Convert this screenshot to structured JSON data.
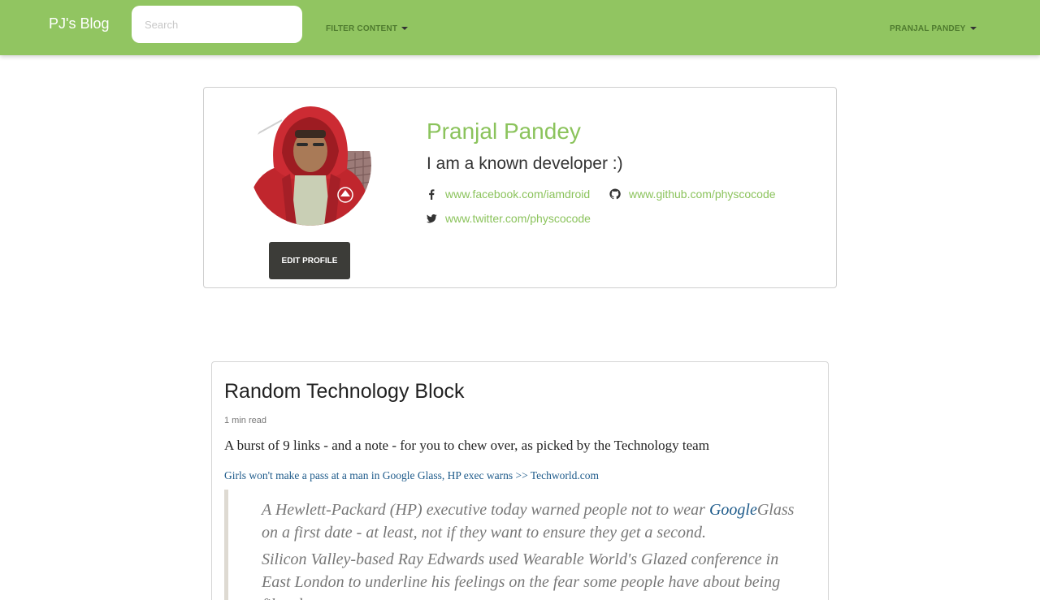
{
  "navbar": {
    "brand": "PJ's Blog",
    "search_placeholder": "Search",
    "filter_label": "FILTER CONTENT",
    "user_label": "PRANJAL PANDEY",
    "bg_color": "#91c561"
  },
  "profile": {
    "name": "Pranjal Pandey",
    "bio": "I am a known developer :)",
    "edit_button": "EDIT PROFILE",
    "links": {
      "facebook": {
        "icon": "facebook-icon",
        "text": "www.facebook.com/iamdroid"
      },
      "github": {
        "icon": "github-icon",
        "text": "www.github.com/physcocode"
      },
      "twitter": {
        "icon": "twitter-icon",
        "text": "www.twitter.com/physcocode"
      }
    },
    "accent_color": "#8bc35c"
  },
  "post": {
    "title": "Random Technology Block",
    "read_time": "1 min read",
    "lead": "A burst of 9 links - and a note - for you to chew over, as picked by the Technology team",
    "link_text": "Girls won't make a pass at a man in Google Glass, HP exec warns >> Techworld.com",
    "quote": {
      "p1_before": "A Hewlett-Packard (HP) executive today warned people not to wear ",
      "p1_link": "Google",
      "p1_after": "Glass on a first date - at least, not if they want to ensure they get a second.",
      "p2": "Silicon Valley-based Ray Edwards used Wearable World's Glazed conference in East London to underline his feelings on the fear some people have about being filmed."
    }
  }
}
